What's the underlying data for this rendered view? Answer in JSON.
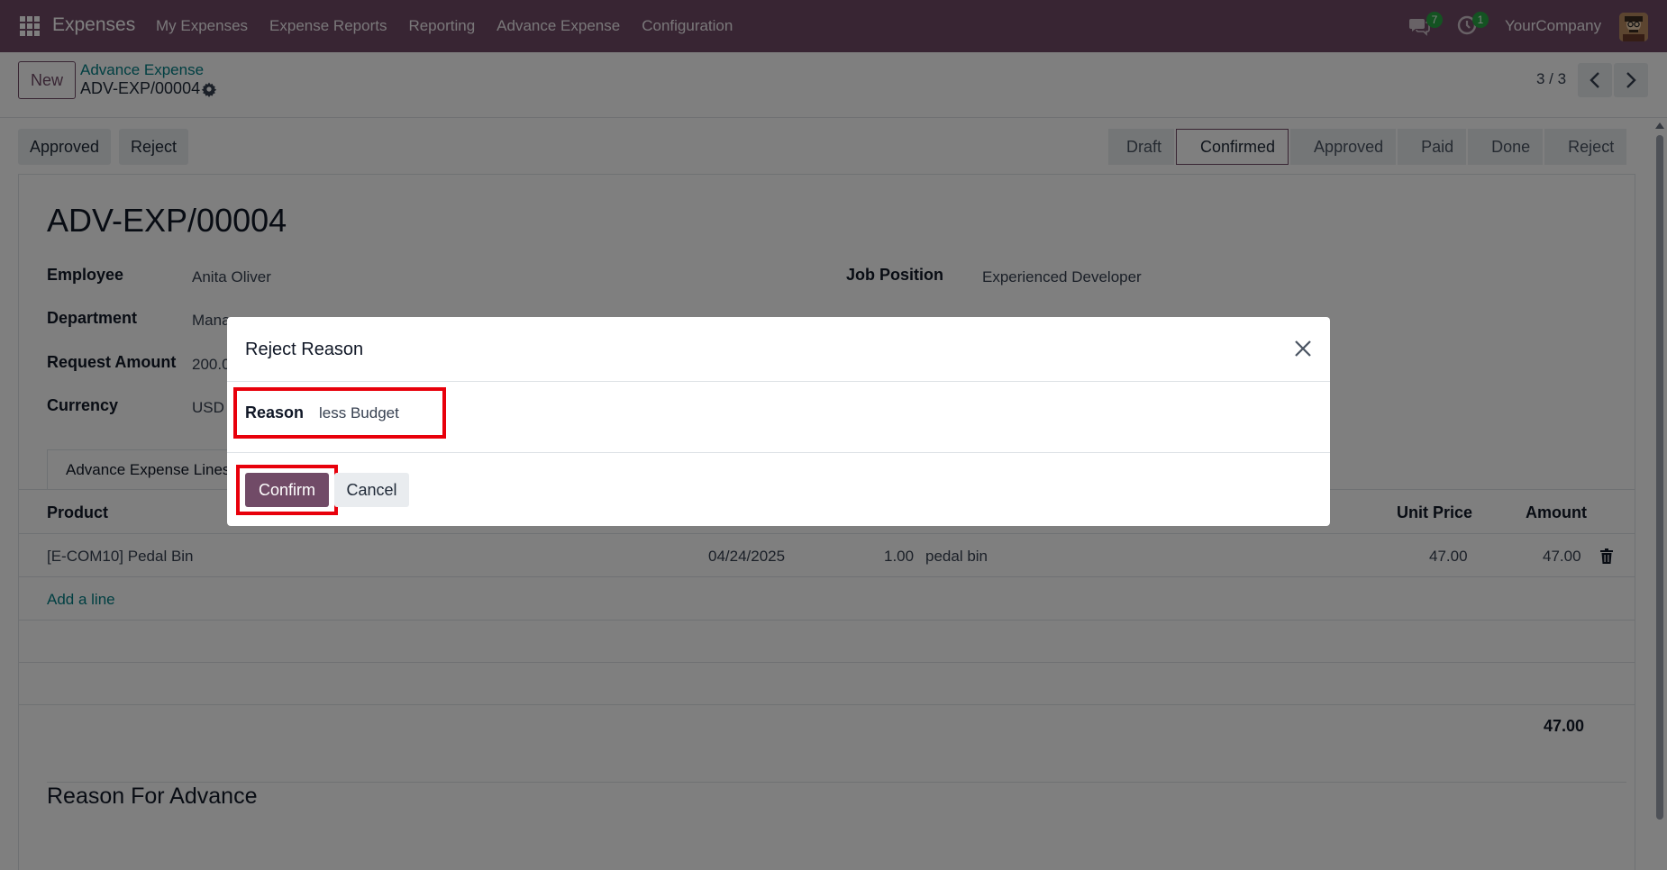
{
  "navbar": {
    "app_name": "Expenses",
    "menu": [
      "My Expenses",
      "Expense Reports",
      "Reporting",
      "Advance Expense",
      "Configuration"
    ],
    "chat_count": "7",
    "activity_count": "1",
    "company": "YourCompany"
  },
  "control": {
    "new_label": "New",
    "breadcrumb_parent": "Advance Expense",
    "breadcrumb_current": "ADV-EXP/00004",
    "pager": "3 / 3"
  },
  "actions": {
    "approved_label": "Approved",
    "reject_label": "Reject"
  },
  "stages": [
    "Draft",
    "Confirmed",
    "Approved",
    "Paid",
    "Done",
    "Reject"
  ],
  "active_stage": "Confirmed",
  "form": {
    "title": "ADV-EXP/00004",
    "employee_label": "Employee",
    "employee_value": "Anita Oliver",
    "department_label": "Department",
    "department_value": "Mana",
    "request_amount_label": "Request Amount",
    "request_amount_value": "200.0",
    "currency_label": "Currency",
    "currency_value": "USD",
    "job_position_label": "Job Position",
    "job_position_value": "Experienced Developer",
    "tab_label": "Advance Expense Lines"
  },
  "table": {
    "headers": {
      "product": "Product",
      "unit_price": "Unit Price",
      "amount": "Amount"
    },
    "rows": [
      {
        "product": "[E-COM10] Pedal Bin",
        "date": "04/24/2025",
        "quantity": "1.00",
        "description": "pedal bin",
        "unit_price": "47.00",
        "amount": "47.00"
      }
    ],
    "add_line": "Add a line",
    "total": "47.00"
  },
  "reason_section_title": "Reason For Advance",
  "dialog": {
    "title": "Reject Reason",
    "reason_label": "Reason",
    "reason_value": "less Budget",
    "confirm_label": "Confirm",
    "cancel_label": "Cancel",
    "highlight_color": "#e8000b"
  },
  "colors": {
    "brand": "#714b67",
    "link": "#017e84",
    "badge": "#28a745"
  }
}
